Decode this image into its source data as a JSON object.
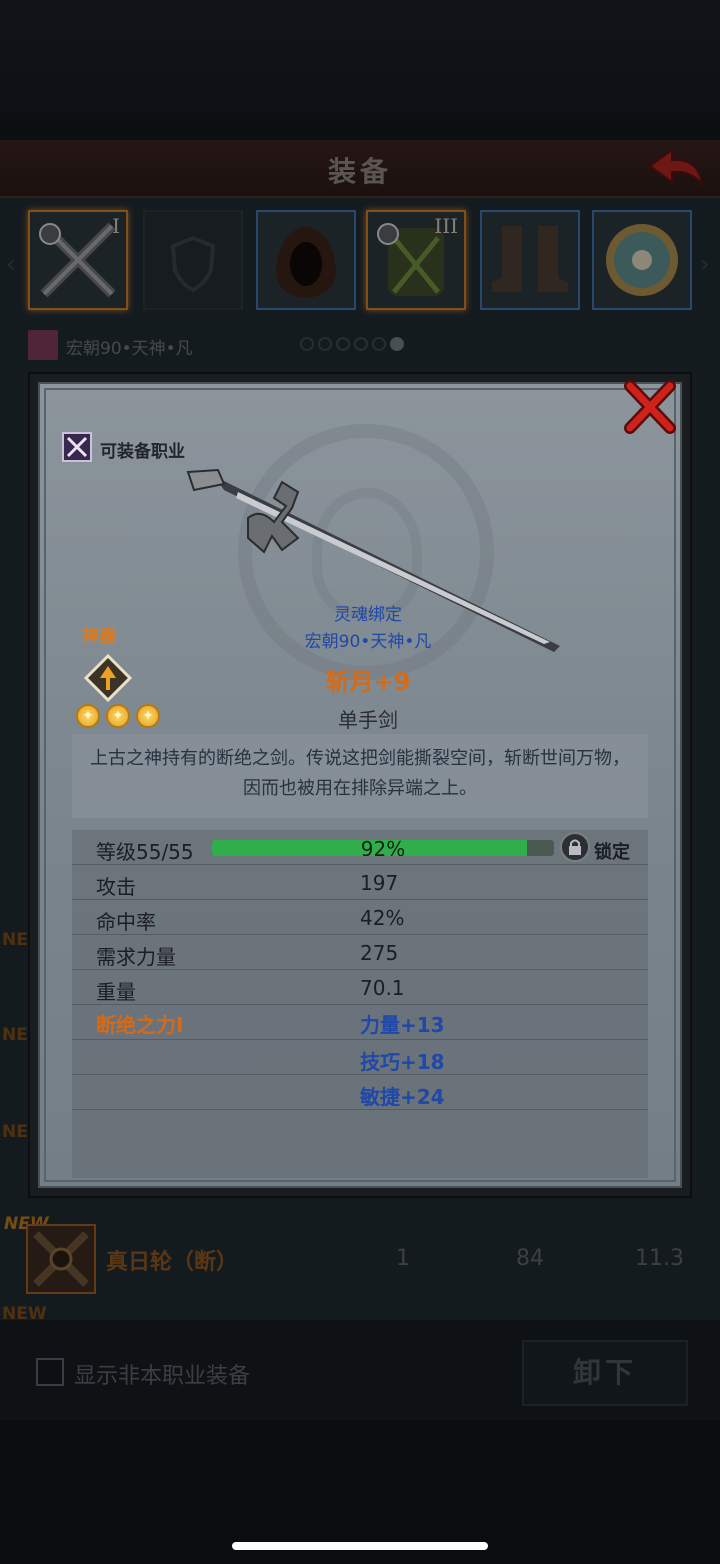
{
  "equipment": {
    "title": "装备",
    "slots": [
      {
        "numeral": "I"
      },
      {
        "numeral": ""
      },
      {
        "numeral": ""
      },
      {
        "numeral": "III"
      },
      {
        "numeral": ""
      },
      {
        "numeral": ""
      }
    ],
    "owner": "宏朝90•天神•凡",
    "list_item": {
      "new_tag": "NEW",
      "name": "真日轮（断）",
      "col1": "1",
      "col2": "84",
      "col3": "11.3"
    },
    "side_new_tags": [
      "NEW",
      "NEW",
      "NEW",
      "NEW"
    ],
    "footer": {
      "checkbox_label": "显示非本职业装备",
      "unequip_label": "卸下"
    }
  },
  "item_detail": {
    "job_label": "可装备职业",
    "artifact_label": "神器",
    "stars": 3,
    "bind_text": "灵魂绑定",
    "owner_text": "宏朝90•天神•凡",
    "name": "斩月+9",
    "type": "单手剑",
    "description": "上古之神持有的断绝之剑。传说这把剑能撕裂空间，斩断世间万物，因而也被用在排除异端之上。",
    "level": {
      "label": "等级55/55",
      "percent_text": "92%",
      "progress": 0.92,
      "lock_label": "锁定"
    },
    "stats": [
      {
        "label": "攻击",
        "value": "197"
      },
      {
        "label": "命中率",
        "value": "42%"
      },
      {
        "label": "需求力量",
        "value": "275"
      },
      {
        "label": "重量",
        "value": "70.1"
      }
    ],
    "set_bonus": {
      "label": "断绝之力I",
      "values": [
        "力量+13",
        "技巧+18",
        "敏捷+24"
      ]
    }
  },
  "colors": {
    "accent_orange": "#d56a17",
    "accent_blue": "#1f48a8",
    "progress_green": "#2fae4b"
  }
}
